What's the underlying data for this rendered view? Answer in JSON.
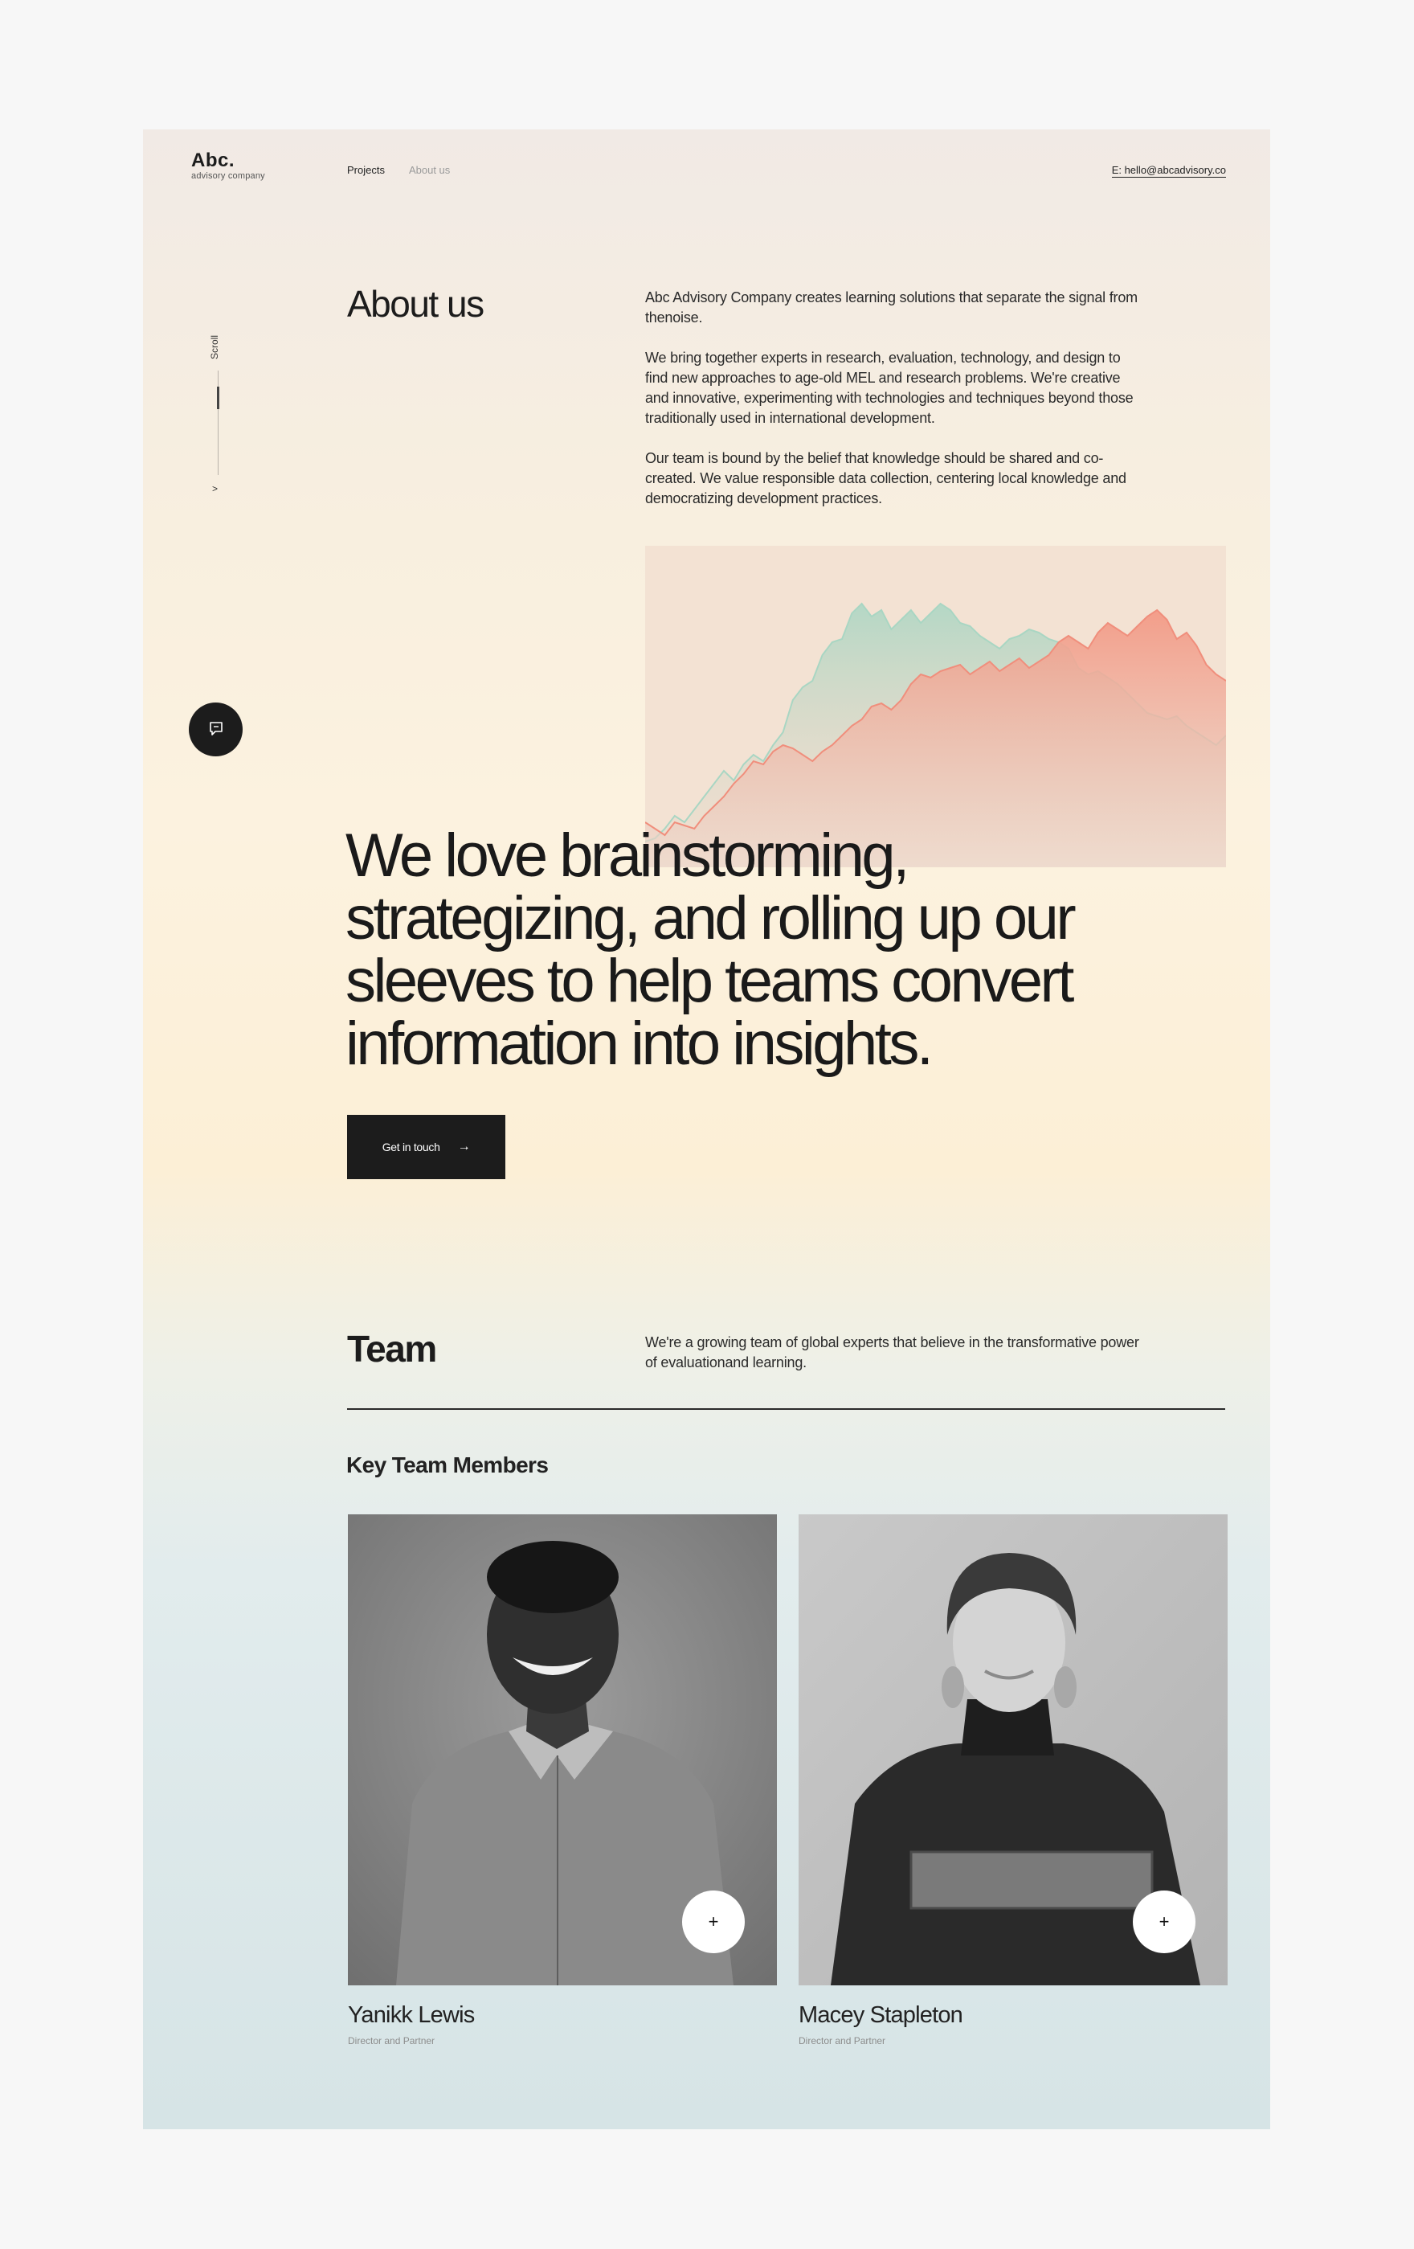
{
  "logo": {
    "mark": "Abc.",
    "sub": "advisory company"
  },
  "nav": {
    "projects": "Projects",
    "about": "About us"
  },
  "contact": {
    "email": "E: hello@abcadvisory.co"
  },
  "scroll": {
    "label": "Scroll",
    "arrow": ">"
  },
  "about": {
    "title": "About us",
    "paragraphs": [
      "Abc Advisory Company creates learning solutions that separate the signal from thenoise.",
      "We bring together experts in research, evaluation, technology, and design to find new approaches to age-old MEL and research problems. We're creative and innovative, experimenting with technologies and techniques beyond those traditionally used in international development.",
      "Our team is bound by the belief that knowledge should be shared and co-created. We value responsible data collection, centering local knowledge and democratizing development practices."
    ]
  },
  "headline": "We love brainstorming, strategizing, and rolling up our sleeves to help teams convert information into insights.",
  "cta": {
    "label": "Get in touch",
    "arrow": "→"
  },
  "team": {
    "title": "Team",
    "description": "We're a growing team of global experts that believe in the transformative power of evaluationand learning.",
    "key_title": "Key Team Members",
    "members": [
      {
        "name": "Yanikk Lewis",
        "role": "Director and Partner",
        "plus": "+"
      },
      {
        "name": "Macey Stapleton",
        "role": "Director and Partner",
        "plus": "+"
      }
    ]
  },
  "colors": {
    "series_green": "#a9d6c3",
    "series_red": "#f08e7c",
    "chart_bg": "#f3e2d3",
    "dark": "#1c1c1c"
  },
  "chart_data": {
    "type": "area",
    "x": [
      0,
      1,
      2,
      3,
      4,
      5,
      6,
      7,
      8,
      9,
      10,
      11,
      12,
      13,
      14,
      15,
      16,
      17,
      18,
      19,
      20,
      21,
      22,
      23,
      24,
      25,
      26,
      27,
      28,
      29,
      30,
      31,
      32,
      33,
      34,
      35,
      36,
      37,
      38,
      39,
      40,
      41,
      42,
      43,
      44,
      45,
      46,
      47,
      48,
      49,
      50,
      51,
      52,
      53,
      54,
      55,
      56,
      57,
      58,
      59
    ],
    "series": [
      {
        "color": "green",
        "values": [
          8,
          9,
          12,
          16,
          14,
          18,
          22,
          26,
          30,
          27,
          32,
          35,
          33,
          38,
          42,
          52,
          56,
          58,
          66,
          70,
          71,
          79,
          82,
          78,
          80,
          74,
          77,
          80,
          76,
          79,
          82,
          80,
          76,
          75,
          72,
          70,
          68,
          71,
          72,
          74,
          73,
          71,
          70,
          68,
          62,
          60,
          61,
          59,
          57,
          54,
          51,
          48,
          47,
          46,
          47,
          44,
          42,
          40,
          38,
          41
        ]
      },
      {
        "color": "red",
        "values": [
          14,
          12,
          10,
          14,
          13,
          12,
          16,
          19,
          22,
          26,
          29,
          33,
          32,
          36,
          38,
          37,
          35,
          33,
          36,
          38,
          41,
          44,
          46,
          50,
          51,
          49,
          52,
          57,
          60,
          59,
          61,
          62,
          63,
          60,
          62,
          64,
          61,
          63,
          65,
          62,
          64,
          66,
          70,
          72,
          70,
          68,
          73,
          76,
          74,
          72,
          75,
          78,
          80,
          77,
          71,
          73,
          69,
          63,
          60,
          58
        ]
      }
    ]
  }
}
